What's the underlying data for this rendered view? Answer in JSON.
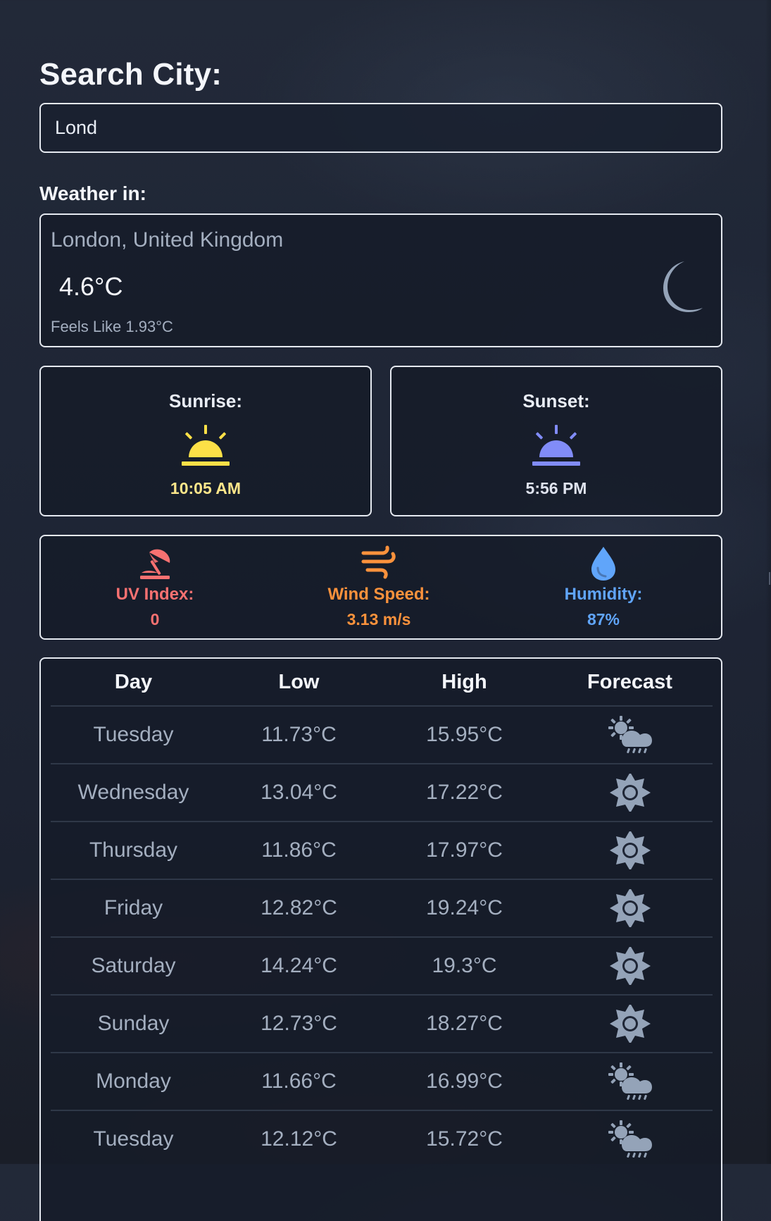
{
  "colors": {
    "text_primary": "#f4f6fb",
    "text_muted": "#a4afc0",
    "panel_border": "#e5e9f0",
    "sunrise": "#fde047",
    "sunset": "#818cf8",
    "uv": "#f87171",
    "wind": "#fb923c",
    "humidity": "#60a5fa",
    "moon": "#94a3b8",
    "forecast_icon": "#94a3b8"
  },
  "search": {
    "title": "Search City:",
    "value": "Lond",
    "placeholder": ""
  },
  "current_weather": {
    "label": "Weather in:",
    "location": "London, United Kingdom",
    "temperature": "4.6°C",
    "feels_like": "Feels Like 1.93°C",
    "icon": "moon-icon"
  },
  "sun": {
    "sunrise": {
      "label": "Sunrise:",
      "time": "10:05 AM",
      "icon": "sunrise-icon"
    },
    "sunset": {
      "label": "Sunset:",
      "time": "5:56 PM",
      "icon": "sunset-icon"
    }
  },
  "stats": [
    {
      "label": "UV Index:",
      "value": "0",
      "icon": "umbrella-beach-icon"
    },
    {
      "label": "Wind Speed:",
      "value": "3.13 m/s",
      "icon": "wind-icon"
    },
    {
      "label": "Humidity:",
      "value": "87%",
      "icon": "water-drop-icon"
    }
  ],
  "forecast": {
    "headers": [
      "Day",
      "Low",
      "High",
      "Forecast"
    ],
    "rows": [
      {
        "day": "Tuesday",
        "low": "11.73°C",
        "high": "15.95°C",
        "icon": "cloud-sun-rain-icon"
      },
      {
        "day": "Wednesday",
        "low": "13.04°C",
        "high": "17.22°C",
        "icon": "sun-icon"
      },
      {
        "day": "Thursday",
        "low": "11.86°C",
        "high": "17.97°C",
        "icon": "sun-icon"
      },
      {
        "day": "Friday",
        "low": "12.82°C",
        "high": "19.24°C",
        "icon": "sun-icon"
      },
      {
        "day": "Saturday",
        "low": "14.24°C",
        "high": "19.3°C",
        "icon": "sun-icon"
      },
      {
        "day": "Sunday",
        "low": "12.73°C",
        "high": "18.27°C",
        "icon": "sun-icon"
      },
      {
        "day": "Monday",
        "low": "11.66°C",
        "high": "16.99°C",
        "icon": "cloud-sun-rain-icon"
      },
      {
        "day": "Tuesday",
        "low": "12.12°C",
        "high": "15.72°C",
        "icon": "cloud-sun-rain-icon"
      }
    ]
  }
}
